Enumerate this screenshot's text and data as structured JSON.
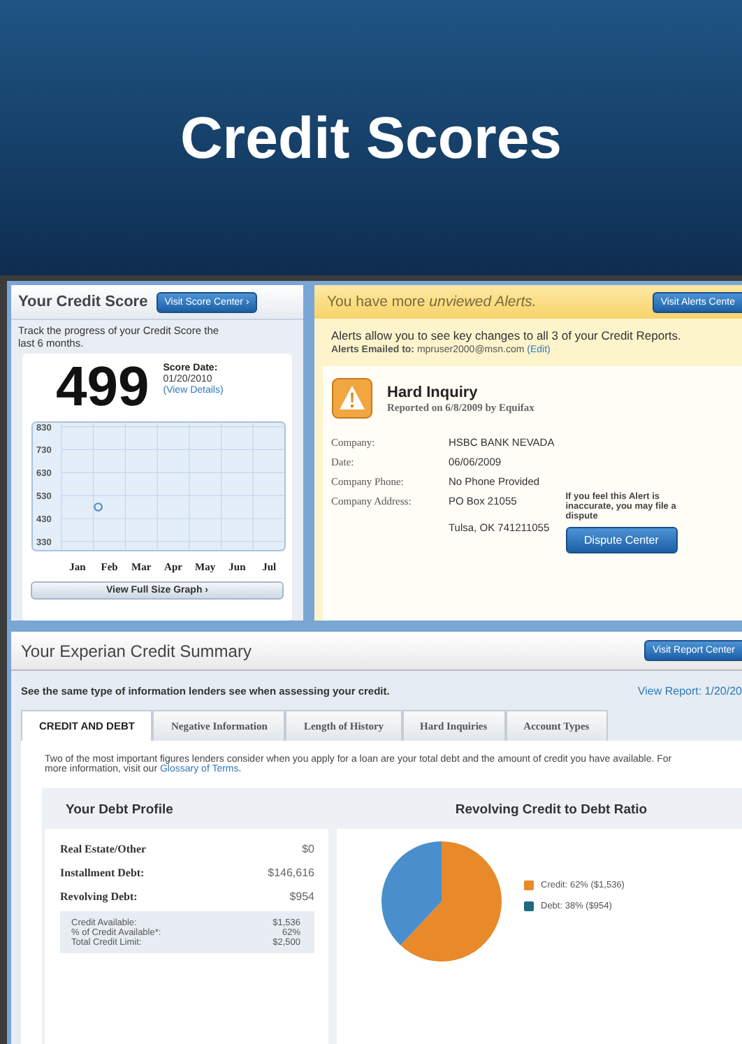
{
  "slide": {
    "title": "Credit Scores"
  },
  "score_panel": {
    "title": "Your Credit Score",
    "button": "Visit Score Center ›",
    "description": "Track the progress of your Credit Score the last 6 months.",
    "score": "499",
    "date_label": "Score Date:",
    "date": "01/20/2010",
    "details_link": "(View Details)",
    "chart_data": {
      "type": "scatter",
      "grid": true,
      "categories": [
        "Jan",
        "Feb",
        "Mar",
        "Apr",
        "May",
        "Jun",
        "Jul"
      ],
      "ylim": [
        290,
        850
      ],
      "yticks": [
        330,
        430,
        530,
        630,
        730,
        830
      ],
      "series": [
        {
          "color": "#5b8fcf",
          "values": [
            null,
            480,
            null,
            null,
            null,
            null,
            null
          ]
        }
      ]
    },
    "graph_button": "View Full Size Graph ›"
  },
  "alerts_panel": {
    "heading": "You have more *unviewed Alerts.*",
    "button": "Visit Alerts Cente",
    "intro": "Alerts allow you to see key changes to all 3 of your Credit Reports.",
    "emailed": "**Alerts Emailed to:** mpruser2000@msn.com ",
    "edit_link": "(Edit)",
    "alert": {
      "title": "Hard Inquiry",
      "reported": "Reported on 6/8/2009 by Equifax",
      "fields": [
        {
          "label": "Company:",
          "value": "HSBC BANK NEVADA"
        },
        {
          "label": "Date:",
          "value": "06/06/2009"
        },
        {
          "label": "Company Phone:",
          "value": "No Phone Provided"
        },
        {
          "label": "Company Address:",
          "value": "PO Box 21055"
        }
      ],
      "address_line_2": "Tulsa, OK 741211055",
      "dispute_note": "If you feel this Alert is inaccurate, you may file a dispute",
      "dispute_button": "Dispute Center"
    }
  },
  "summary": {
    "title": "Your Experian Credit Summary",
    "button": "Visit Report Center",
    "subtitle": "See the same type of information lenders see when assessing your credit.",
    "report_link": "View Report: 1/20/20",
    "tabs": [
      {
        "label": "CREDIT AND DEBT",
        "selected": true
      },
      {
        "label": "Negative Information",
        "selected": false
      },
      {
        "label": "Length of History",
        "selected": false
      },
      {
        "label": "Hard Inquiries",
        "selected": false
      },
      {
        "label": "Account Types",
        "selected": false
      }
    ],
    "intro": "Two of the most important figures lenders consider when you apply for a loan are your total debt and the amount of credit you have available. For more information, visit our ",
    "glossary_link": "Glossary of Terms",
    "intro_end": ".",
    "debt_profile": {
      "title": "Your Debt Profile",
      "rows": [
        {
          "label": "Real Estate/Other",
          "value": "$0"
        },
        {
          "label": "Installment Debt:",
          "value": "$146,616"
        },
        {
          "label": "Revolving Debt:",
          "value": "$954"
        }
      ],
      "details": [
        {
          "label": "Credit Available:",
          "value": "$1,536"
        },
        {
          "label": "% of Credit Available*:",
          "value": "62%"
        },
        {
          "label": "Total Credit Limit:",
          "value": "$2,500"
        }
      ]
    },
    "ratio": {
      "title": "Revolving Credit to Debt Ratio",
      "chart_data": {
        "type": "pie",
        "series": [
          {
            "values": [
              62,
              38
            ]
          }
        ]
      },
      "legend": [
        {
          "label": "Credit: 62% ($1,536)",
          "color": "#e8892a"
        },
        {
          "label": "Debt: 38% ($954)",
          "color": "#1f6a80"
        }
      ]
    }
  }
}
